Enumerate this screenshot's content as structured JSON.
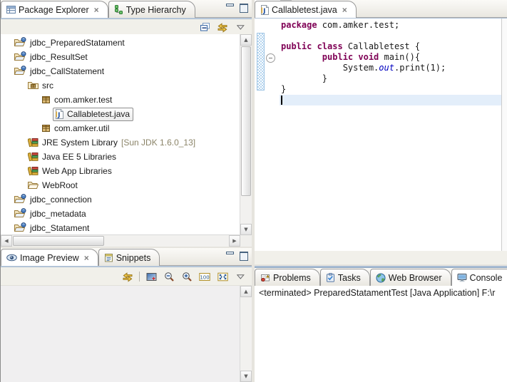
{
  "colors": {
    "keyword": "#7f0055",
    "static_field": "#0000c0",
    "accent_band": "#8ba4c0",
    "selection_line": "#e3eefa"
  },
  "package_explorer": {
    "tabs": [
      {
        "label": "Package Explorer",
        "icon": "package-explorer",
        "active": true,
        "closable": true
      },
      {
        "label": "Type Hierarchy",
        "icon": "type-hierarchy",
        "active": false,
        "closable": false
      }
    ],
    "toolbar": [
      {
        "icon": "collapse-all"
      },
      {
        "icon": "link-with-editor"
      },
      {
        "icon": "view-menu"
      }
    ],
    "tree": [
      {
        "label": "jdbc_PreparedStatament",
        "icon": "java-project",
        "level": 0
      },
      {
        "label": "jdbc_ResultSet",
        "icon": "java-project",
        "level": 0
      },
      {
        "label": "jdbc_CallStatement",
        "icon": "java-project",
        "level": 0
      },
      {
        "label": "src",
        "icon": "source-folder",
        "level": 1
      },
      {
        "label": "com.amker.test",
        "icon": "package",
        "level": 2
      },
      {
        "label": "Callabletest.java",
        "icon": "java-file",
        "level": 3,
        "selected": true
      },
      {
        "label": "com.amker.util",
        "icon": "package",
        "level": 2
      },
      {
        "label": "JRE System Library",
        "suffix": " [Sun JDK 1.6.0_13]",
        "icon": "library",
        "level": 1
      },
      {
        "label": "Java EE 5 Libraries",
        "icon": "library",
        "level": 1
      },
      {
        "label": "Web App Libraries",
        "icon": "library",
        "level": 1
      },
      {
        "label": "WebRoot",
        "icon": "folder",
        "level": 1
      },
      {
        "label": "jdbc_connection",
        "icon": "java-project",
        "level": 0
      },
      {
        "label": "jdbc_metadata",
        "icon": "java-project",
        "level": 0
      },
      {
        "label": "jdbc_Statament",
        "icon": "java-project",
        "level": 0
      }
    ]
  },
  "image_preview": {
    "tabs": [
      {
        "label": "Image Preview",
        "icon": "image-preview",
        "active": true,
        "closable": true
      },
      {
        "label": "Snippets",
        "icon": "snippets",
        "active": false,
        "closable": false
      }
    ],
    "toolbar": [
      {
        "icon": "link-with-editor"
      },
      {
        "icon": "separator"
      },
      {
        "icon": "image"
      },
      {
        "icon": "zoom-out"
      },
      {
        "icon": "zoom-in"
      },
      {
        "icon": "zoom-100"
      },
      {
        "icon": "zoom-fit"
      },
      {
        "icon": "view-menu"
      }
    ]
  },
  "editor": {
    "tabs": [
      {
        "label": "Callabletest.java",
        "icon": "java-file",
        "active": true,
        "closable": true
      }
    ],
    "code": [
      {
        "tokens": [
          {
            "t": "package",
            "s": "kw"
          },
          {
            "t": " com.amker.test;",
            "s": "pl"
          }
        ]
      },
      {
        "tokens": []
      },
      {
        "tokens": [
          {
            "t": "public class",
            "s": "kw"
          },
          {
            "t": " Callabletest {",
            "s": "pl"
          }
        ]
      },
      {
        "tokens": [
          {
            "t": "        ",
            "s": "pl"
          },
          {
            "t": "public void",
            "s": "kw"
          },
          {
            "t": " main(){",
            "s": "pl"
          }
        ],
        "fold": true
      },
      {
        "tokens": [
          {
            "t": "            System.",
            "s": "pl"
          },
          {
            "t": "out",
            "s": "fld"
          },
          {
            "t": ".print(1);",
            "s": "pl"
          }
        ]
      },
      {
        "tokens": [
          {
            "t": "        }",
            "s": "pl"
          }
        ]
      },
      {
        "tokens": [
          {
            "t": "}",
            "s": "pl"
          }
        ]
      },
      {
        "tokens": [],
        "caret": true
      }
    ]
  },
  "console": {
    "tabs": [
      {
        "label": "Problems",
        "icon": "problems",
        "active": false,
        "closable": false
      },
      {
        "label": "Tasks",
        "icon": "tasks",
        "active": false,
        "closable": false
      },
      {
        "label": "Web Browser",
        "icon": "web-browser",
        "active": false,
        "closable": false
      },
      {
        "label": "Console",
        "icon": "console",
        "active": true,
        "closable": true
      }
    ],
    "status": "<terminated> PreparedStatamentTest [Java Application] F:\\r"
  }
}
